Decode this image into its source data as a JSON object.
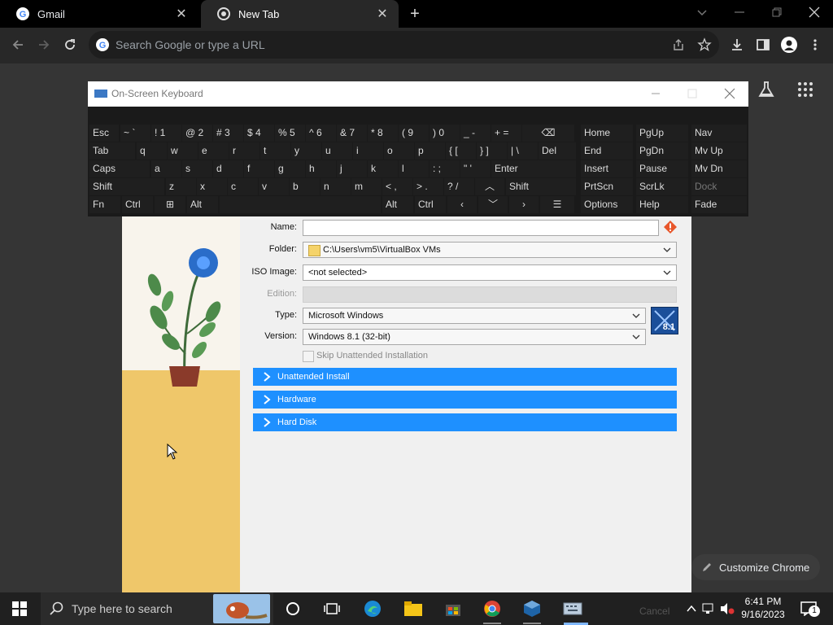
{
  "tabs": [
    {
      "title": "Gmail",
      "icon": "google-g-icon"
    },
    {
      "title": "New Tab",
      "icon": "chrome-icon"
    }
  ],
  "omnibox": {
    "placeholder": "Search Google or type a URL"
  },
  "osk": {
    "title": "On-Screen Keyboard",
    "rows": [
      [
        "Esc",
        "~ `",
        "! 1",
        "@ 2",
        "# 3",
        "$ 4",
        "% 5",
        "^ 6",
        "& 7",
        "* 8",
        "( 9",
        ") 0",
        "_ -",
        "+ ="
      ],
      [
        "Tab",
        "q",
        "w",
        "e",
        "r",
        "t",
        "y",
        "u",
        "i",
        "o",
        "p",
        "{ [",
        "} ]",
        "| \\",
        "Del"
      ],
      [
        "Caps",
        "a",
        "s",
        "d",
        "f",
        "g",
        "h",
        "j",
        "k",
        "l",
        ": ;",
        "\" '",
        "Enter"
      ],
      [
        "Shift",
        "z",
        "x",
        "c",
        "v",
        "b",
        "n",
        "m",
        "< ,",
        "> .",
        "? /",
        "Shift"
      ],
      [
        "Fn",
        "Ctrl",
        "Alt",
        "Alt",
        "Ctrl"
      ]
    ],
    "nav_keys": [
      [
        "Home",
        "PgUp",
        "Nav"
      ],
      [
        "End",
        "PgDn",
        "Mv Up"
      ],
      [
        "Insert",
        "Pause",
        "Mv Dn"
      ],
      [
        "PrtScn",
        "ScrLk",
        "Dock"
      ],
      [
        "Options",
        "Help",
        "Fade"
      ]
    ]
  },
  "vbox": {
    "name_label": "Name:",
    "name_value": "",
    "folder_label": "Folder:",
    "folder_value": "C:\\Users\\vm5\\VirtualBox VMs",
    "iso_label": "ISO Image:",
    "iso_value": "<not selected>",
    "edition_label": "Edition:",
    "edition_value": "",
    "type_label": "Type:",
    "type_value": "Microsoft Windows",
    "version_label": "Version:",
    "version_value": "Windows 8.1 (32-bit)",
    "os_badge": "8.1",
    "skip_label": "Skip Unattended Installation",
    "sections": [
      "Unattended Install",
      "Hardware",
      "Hard Disk"
    ],
    "cancel_label": "Cancel"
  },
  "customize_chrome": "Customize Chrome",
  "taskbar": {
    "search_placeholder": "Type here to search",
    "time": "6:41 PM",
    "date": "9/16/2023",
    "notification_count": "1"
  }
}
